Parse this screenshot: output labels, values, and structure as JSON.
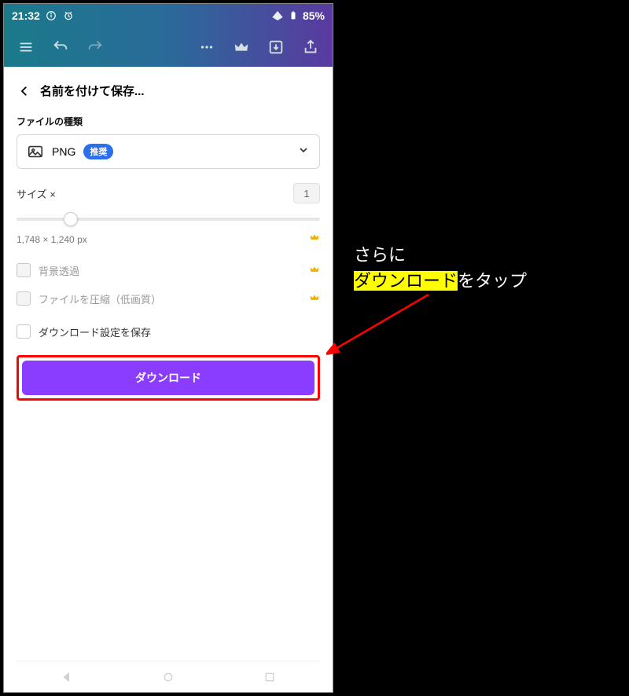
{
  "status": {
    "time": "21:32",
    "battery": "85%"
  },
  "sheet": {
    "title": "名前を付けて保存...",
    "file_type_label": "ファイルの種類",
    "file_type_value": "PNG",
    "file_type_badge": "推奨",
    "size_label": "サイズ ×",
    "size_value": "1",
    "dimensions": "1,748 × 1,240 px",
    "option_transparent": "背景透過",
    "option_compress": "ファイルを圧縮（低画質）",
    "option_save_settings": "ダウンロード設定を保存",
    "download_button": "ダウンロード"
  },
  "annotation": {
    "line1": "さらに",
    "highlight": "ダウンロード",
    "line2_rest": "をタップ"
  }
}
